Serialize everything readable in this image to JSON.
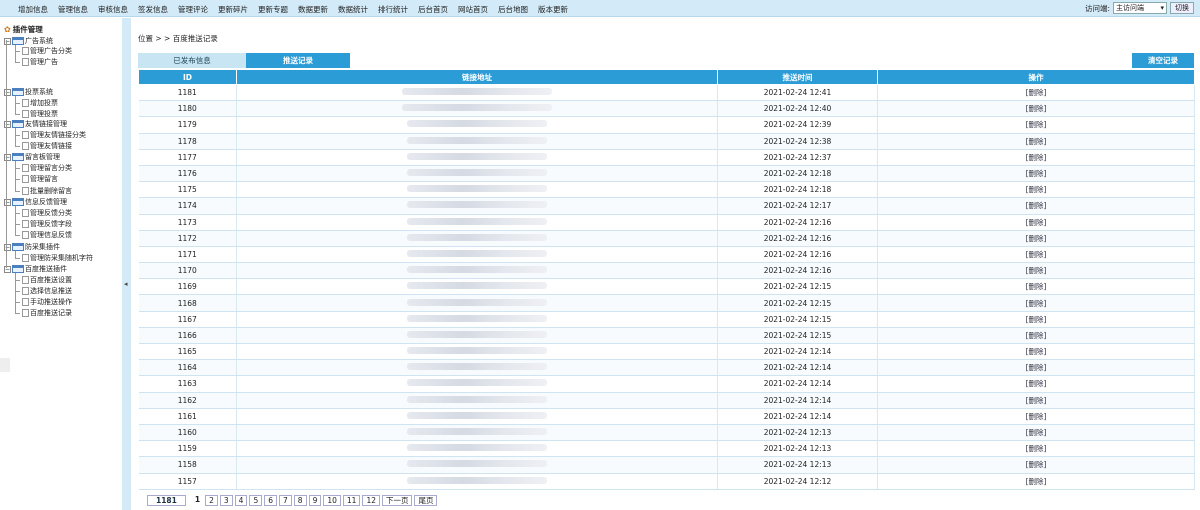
{
  "topnav": [
    "增加信息",
    "管理信息",
    "审核信息",
    "签发信息",
    "管理评论",
    "更新碎片",
    "更新专题",
    "数据更新",
    "数据统计",
    "排行统计",
    "后台首页",
    "网站首页",
    "后台地图",
    "版本更新"
  ],
  "visit": {
    "label": "访问端:",
    "selected": "主访问端",
    "switch": "切换"
  },
  "sidebar": {
    "title": "插件管理",
    "groups": [
      {
        "label": "广告系统",
        "items": [
          "管理广告分类",
          "管理广告"
        ]
      },
      {
        "label": "投票系统",
        "items": [
          "增加投票",
          "管理投票"
        ]
      },
      {
        "label": "友情链接管理",
        "items": [
          "管理友情链接分类",
          "管理友情链接"
        ]
      },
      {
        "label": "留言板管理",
        "items": [
          "管理留言分类",
          "管理留言",
          "批量删除留言"
        ]
      },
      {
        "label": "信息反馈管理",
        "items": [
          "管理反馈分类",
          "管理反馈字段",
          "管理信息反馈"
        ]
      },
      {
        "label": "防采集插件",
        "items": [
          "管理防采集随机字符"
        ]
      },
      {
        "label": "百度推送插件",
        "items": [
          "百度推送设置",
          "选择信息推送",
          "手动推送操作",
          "百度推送记录"
        ]
      }
    ]
  },
  "breadcrumb": "位置 > > 百度推送记录",
  "tabs": {
    "published": "已发布信息",
    "records": "推送记录",
    "clear": "清空记录"
  },
  "table": {
    "headers": [
      "ID",
      "链接地址",
      "推送时间",
      "操作"
    ],
    "action_label": "[删除]",
    "rows": [
      {
        "id": "1181",
        "time": "2021-02-24 12:41"
      },
      {
        "id": "1180",
        "time": "2021-02-24 12:40"
      },
      {
        "id": "1179",
        "time": "2021-02-24 12:39"
      },
      {
        "id": "1178",
        "time": "2021-02-24 12:38"
      },
      {
        "id": "1177",
        "time": "2021-02-24 12:37"
      },
      {
        "id": "1176",
        "time": "2021-02-24 12:18"
      },
      {
        "id": "1175",
        "time": "2021-02-24 12:18"
      },
      {
        "id": "1174",
        "time": "2021-02-24 12:17"
      },
      {
        "id": "1173",
        "time": "2021-02-24 12:16"
      },
      {
        "id": "1172",
        "time": "2021-02-24 12:16"
      },
      {
        "id": "1171",
        "time": "2021-02-24 12:16"
      },
      {
        "id": "1170",
        "time": "2021-02-24 12:16"
      },
      {
        "id": "1169",
        "time": "2021-02-24 12:15"
      },
      {
        "id": "1168",
        "time": "2021-02-24 12:15"
      },
      {
        "id": "1167",
        "time": "2021-02-24 12:15"
      },
      {
        "id": "1166",
        "time": "2021-02-24 12:15"
      },
      {
        "id": "1165",
        "time": "2021-02-24 12:14"
      },
      {
        "id": "1164",
        "time": "2021-02-24 12:14"
      },
      {
        "id": "1163",
        "time": "2021-02-24 12:14"
      },
      {
        "id": "1162",
        "time": "2021-02-24 12:14"
      },
      {
        "id": "1161",
        "time": "2021-02-24 12:14"
      },
      {
        "id": "1160",
        "time": "2021-02-24 12:13"
      },
      {
        "id": "1159",
        "time": "2021-02-24 12:13"
      },
      {
        "id": "1158",
        "time": "2021-02-24 12:13"
      },
      {
        "id": "1157",
        "time": "2021-02-24 12:12"
      }
    ]
  },
  "pager": {
    "total": "1181",
    "current": "1",
    "pages": [
      "2",
      "3",
      "4",
      "5",
      "6",
      "7",
      "8",
      "9",
      "10",
      "11",
      "12"
    ],
    "next": "下一页",
    "last": "尾页"
  },
  "colors": {
    "accent": "#2c9cd6",
    "topbar": "#d3ebf8",
    "tab_inactive": "#c7e5f3"
  }
}
